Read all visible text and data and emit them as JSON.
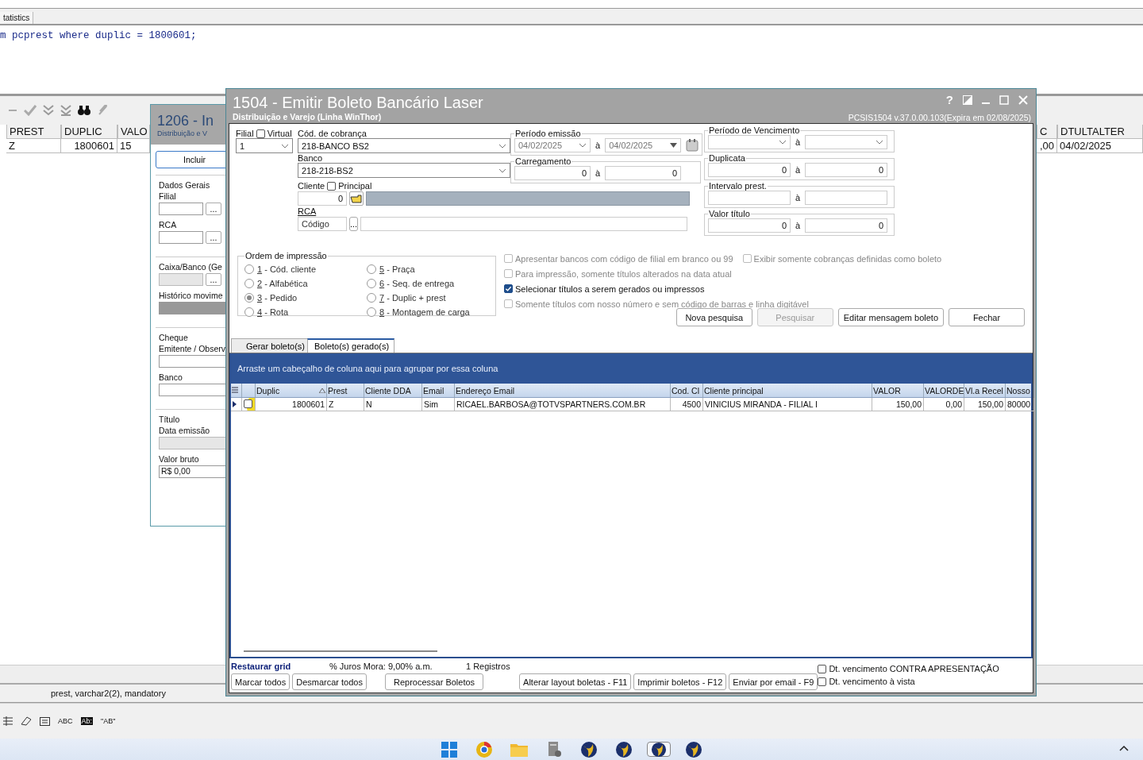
{
  "background_window": {
    "tab": "tatistics",
    "sql": "m pcprest where duplic = 1800601;",
    "grid_left": {
      "columns": [
        "PREST",
        "DUPLIC",
        "VALO"
      ],
      "row": [
        "Z",
        "1800601",
        "15"
      ]
    },
    "grid_right": {
      "columns": [
        "C",
        "DTULTALTER"
      ],
      "row": [
        ",00",
        "04/02/2025"
      ]
    },
    "status_text": "prest, varchar2(2), mandatory",
    "toolbar_texts": [
      "ABC",
      "Ab:",
      "\"AB\""
    ]
  },
  "middle_window": {
    "title": "1206 - In",
    "subtitle": "Distribuição e V",
    "button": "Incluir",
    "sections": [
      {
        "title": "Dados Gerais",
        "fields": [
          {
            "label": "Filial",
            "kind": "lookup",
            "button": "..."
          },
          {
            "label": "RCA",
            "kind": "lookup",
            "button": "..."
          }
        ]
      },
      {
        "fields": [
          {
            "label": "Caixa/Banco (Ge",
            "kind": "lookup_disabled",
            "button": "..."
          },
          {
            "label": "Histórico movime",
            "kind": "dark"
          }
        ]
      },
      {
        "title": "Cheque",
        "fields": [
          {
            "label": "Emitente / Observ",
            "kind": "text"
          },
          {
            "label": "Banco",
            "kind": "text"
          }
        ]
      },
      {
        "title": "Título",
        "fields": [
          {
            "label": "Data emissão",
            "kind": "disabled"
          },
          {
            "label": "Valor bruto",
            "kind": "text",
            "value": "R$ 0,00"
          }
        ]
      }
    ]
  },
  "dialog": {
    "title": "1504 - Emitir Boleto Bancário Laser",
    "subtitle": "Distribuição e Varejo (Linha WinThor)",
    "version": "PCSIS1504  v.37.0.00.103(Expira em 02/08/2025)",
    "help": "?",
    "filial": {
      "label": "Filial",
      "value": "1"
    },
    "virtual": {
      "label": "Virtual",
      "checked": false
    },
    "cobranca": {
      "label": "Cód. de cobrança",
      "value": "218-BANCO BS2"
    },
    "banco": {
      "label": "Banco",
      "value": "218-218-BS2"
    },
    "cliente": {
      "label": "Cliente",
      "value": "0"
    },
    "principal": {
      "label": "Principal",
      "checked": false
    },
    "rca": {
      "label": "RCA",
      "placeholder": "Código",
      "button": "..."
    },
    "ranges_middle": [
      {
        "label": "Período emissão",
        "kind": "date_calendar",
        "from": "04/02/2025",
        "sep": "à",
        "to": "04/02/2025"
      },
      {
        "label": "Carregamento",
        "kind": "number",
        "from": "0",
        "sep": "à",
        "to": "0"
      }
    ],
    "ranges_right": [
      {
        "label": "Período de Vencimento",
        "kind": "date",
        "sep": "à"
      },
      {
        "label": "Duplicata",
        "kind": "number",
        "from": "0",
        "sep": "à",
        "to": "0"
      },
      {
        "label": "Intervalo prest.",
        "kind": "number",
        "sep": "à"
      },
      {
        "label": "Valor título",
        "kind": "number",
        "from": "0",
        "sep": "à",
        "to": "0"
      }
    ],
    "ordem": {
      "label": "Ordem de impressão",
      "options": [
        {
          "key": "1",
          "text": "- Cód. cliente",
          "selected": false
        },
        {
          "key": "2",
          "text": "- Alfabética",
          "selected": false
        },
        {
          "key": "3",
          "text": "- Pedido",
          "selected": true
        },
        {
          "key": "4",
          "text": "- Rota",
          "selected": false
        },
        {
          "key": "5",
          "text": "- Praça",
          "selected": false
        },
        {
          "key": "6",
          "text": "- Seq. de entrega",
          "selected": false
        },
        {
          "key": "7",
          "text": "- Duplic + prest",
          "selected": false
        },
        {
          "key": "8",
          "text": "- Montagem de carga",
          "selected": false
        }
      ]
    },
    "option_rows": [
      [
        {
          "label": "Apresentar bancos com código de filial em branco ou 99",
          "checked": false,
          "disabled": true
        },
        {
          "label": "Exibir somente cobranças definidas como boleto",
          "checked": false,
          "disabled": true
        }
      ],
      [
        {
          "label": "Para impressão, somente títulos alterados na data atual",
          "checked": false,
          "disabled": true
        }
      ],
      [
        {
          "label": "Selecionar títulos a serem gerados ou impressos",
          "checked": true,
          "disabled": false
        }
      ],
      [
        {
          "label": "Somente títulos com nosso número e sem código de barras e linha digitável",
          "checked": false,
          "disabled": true
        }
      ]
    ],
    "buttons": [
      {
        "label": "Nova pesquisa",
        "disabled": false
      },
      {
        "label": "Pesquisar",
        "disabled": true
      },
      {
        "label": "Editar mensagem boleto",
        "disabled": false
      },
      {
        "label": "Fechar",
        "disabled": false
      }
    ],
    "tabs": [
      {
        "label": "Gerar boleto(s)",
        "selected": false
      },
      {
        "label": "Boleto(s) gerado(s)",
        "selected": true
      }
    ],
    "group_hint": "Arraste um cabeçalho de coluna aqui para agrupar por essa coluna",
    "grid": {
      "columns": [
        {
          "label": "Duplic",
          "sorted": true
        },
        {
          "label": "Prest"
        },
        {
          "label": "Cliente DDA"
        },
        {
          "label": "Email"
        },
        {
          "label": "Endereço Email"
        },
        {
          "label": "Cod. Cl"
        },
        {
          "label": "Cliente principal"
        },
        {
          "label": "VALOR"
        },
        {
          "label": "VALORDE"
        },
        {
          "label": "Vl.a Recel"
        },
        {
          "label": "Nosso"
        }
      ],
      "rows": [
        {
          "checked": false,
          "cells": [
            "1800601",
            "Z",
            "N",
            "Sim",
            "RICAEL.BARBOSA@TOTVSPARTNERS.COM.BR",
            "4500",
            "VINICIUS MIRANDA - FILIAL I",
            "150,00",
            "0,00",
            "150,00",
            "80000"
          ]
        }
      ]
    },
    "footer": {
      "restore": "Restaurar grid",
      "juros": "% Juros Mora: 9,00% a.m.",
      "count": "1 Registros",
      "buttons": [
        "Marcar todos",
        "Desmarcar todos",
        "Reprocessar Boletos",
        "Alterar layout boletas - F11",
        "Imprimir boletos - F12",
        "Enviar por email - F9"
      ],
      "checks": [
        {
          "label": "Dt. vencimento CONTRA APRESENTAÇÃO",
          "checked": false
        },
        {
          "label": "Dt. vencimento à vista",
          "checked": false
        }
      ]
    }
  },
  "taskbar": {
    "apps": [
      {
        "kind": "start",
        "selected": false
      },
      {
        "kind": "browser",
        "selected": false
      },
      {
        "kind": "folder",
        "selected": false
      },
      {
        "kind": "server",
        "selected": false
      },
      {
        "kind": "swirl",
        "selected": false
      },
      {
        "kind": "swirl",
        "selected": false
      },
      {
        "kind": "swirl",
        "selected": true
      },
      {
        "kind": "swirl",
        "selected": false
      }
    ]
  }
}
